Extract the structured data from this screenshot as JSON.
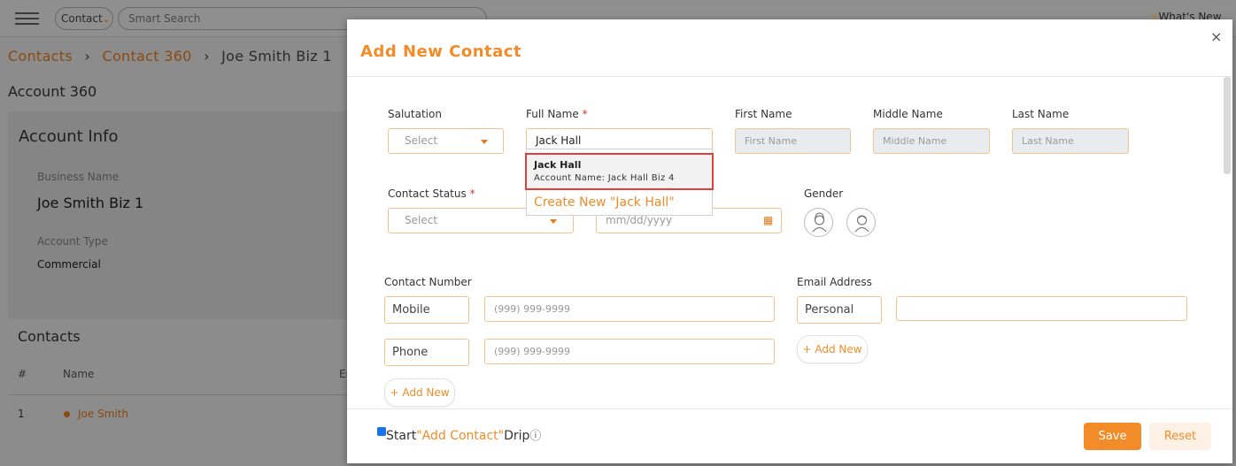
{
  "topbar": {
    "context_select": "Contact",
    "search_placeholder": "Smart Search",
    "whats_new": "What's New"
  },
  "breadcrumb": {
    "items": [
      "Contacts",
      "Contact 360",
      "Joe Smith Biz 1"
    ]
  },
  "page": {
    "title": "Account 360",
    "account_info": {
      "heading": "Account Info",
      "business_name_label": "Business Name",
      "business_name_value": "Joe Smith Biz 1",
      "account_type_label": "Account Type",
      "account_type_value": "Commercial"
    },
    "contacts": {
      "heading": "Contacts",
      "columns": [
        "#",
        "Name",
        "Em"
      ],
      "rows": [
        {
          "num": "1",
          "name": "Joe Smith"
        }
      ]
    }
  },
  "modal": {
    "title": "Add New Contact",
    "close": "×",
    "salutation": {
      "label": "Salutation",
      "value": "Select"
    },
    "full_name": {
      "label": "Full Name",
      "required": "*",
      "value": "Jack Hall"
    },
    "first_name": {
      "label": "First Name",
      "placeholder": "First Name"
    },
    "middle_name": {
      "label": "Middle Name",
      "placeholder": "Middle Name"
    },
    "last_name": {
      "label": "Last Name",
      "placeholder": "Last Name"
    },
    "suggestion": {
      "name": "Jack Hall",
      "account": "Account Name: Jack Hall Biz 4",
      "create": "Create New \"Jack Hall\""
    },
    "contact_status": {
      "label": "Contact Status",
      "required": "*",
      "value": "Select"
    },
    "date": {
      "placeholder": "mm/dd/yyyy"
    },
    "gender": {
      "label": "Gender"
    },
    "contact_number": {
      "label": "Contact Number",
      "rows": [
        {
          "type": "Mobile",
          "placeholder": "(999) 999-9999"
        },
        {
          "type": "Phone",
          "placeholder": "(999) 999-9999"
        }
      ],
      "add_new": "+ Add New"
    },
    "email": {
      "label": "Email Address",
      "type": "Personal",
      "add_new": "+ Add New"
    },
    "footer": {
      "drip_start": "Start",
      "drip_name": "\"Add Contact\"",
      "drip_end": "Drip",
      "info": "ⓘ",
      "save": "Save",
      "reset": "Reset"
    }
  },
  "colors": {
    "accent": "#f28c28",
    "highlight": "#e0403a"
  }
}
